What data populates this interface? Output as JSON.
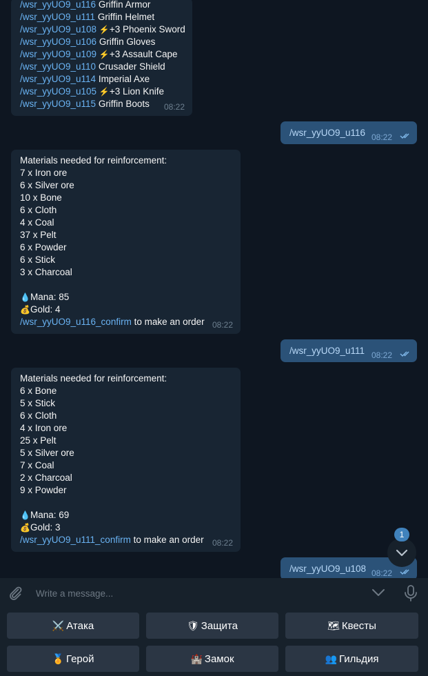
{
  "chat": {
    "msg1": {
      "lines": [
        {
          "cmd": "/wsr_yyUO9_u116",
          "text": " Griffin Armor"
        },
        {
          "cmd": "/wsr_yyUO9_u111",
          "text": " Griffin Helmet"
        },
        {
          "cmd": "/wsr_yyUO9_u108",
          "icon": "⚡",
          "text": "+3 Phoenix Sword"
        },
        {
          "cmd": "/wsr_yyUO9_u106",
          "text": " Griffin Gloves"
        },
        {
          "cmd": "/wsr_yyUO9_u109",
          "icon": "⚡",
          "text": "+3 Assault Cape"
        },
        {
          "cmd": "/wsr_yyUO9_u110",
          "text": " Crusader Shield"
        },
        {
          "cmd": "/wsr_yyUO9_u114",
          "text": " Imperial Axe"
        },
        {
          "cmd": "/wsr_yyUO9_u105",
          "icon": "⚡",
          "text": "+3 Lion Knife"
        },
        {
          "cmd": "/wsr_yyUO9_u115",
          "text": " Griffin Boots"
        }
      ],
      "time": "08:22"
    },
    "out1": {
      "text": "/wsr_yyUO9_u116",
      "time": "08:22"
    },
    "msg2": {
      "header": "Materials needed for reinforcement:",
      "items": [
        "7 x Iron ore",
        "6 x Silver ore",
        "10 x Bone",
        "6 x Cloth",
        "4 x Coal",
        "37 x Pelt",
        "6 x Powder",
        "6 x Stick",
        "3 x Charcoal"
      ],
      "mana": "Mana: 85",
      "gold": "Gold: 4",
      "confirm_cmd": "/wsr_yyUO9_u116_confirm",
      "confirm_text": " to make an order",
      "time": "08:22"
    },
    "out2": {
      "text": "/wsr_yyUO9_u111",
      "time": "08:22"
    },
    "msg3": {
      "header": "Materials needed for reinforcement:",
      "items": [
        "6 x Bone",
        "5 x Stick",
        "6 x Cloth",
        "4 x Iron ore",
        "25 x Pelt",
        "5 x Silver ore",
        "7 x Coal",
        "2 x Charcoal",
        "9 x Powder"
      ],
      "mana": "Mana: 69",
      "gold": "Gold: 3",
      "confirm_cmd": "/wsr_yyUO9_u111_confirm",
      "confirm_text": " to make an order",
      "time": "08:22"
    },
    "out3": {
      "text": "/wsr_yyUO9_u108",
      "time": "08:22"
    },
    "icons": {
      "mana": "💧",
      "gold": "💰"
    }
  },
  "scroll": {
    "badge": "1"
  },
  "composer": {
    "placeholder": "Write a message..."
  },
  "keyboard": {
    "buttons": [
      {
        "icon": "⚔️",
        "label": "Атака"
      },
      {
        "icon": "🛡",
        "label": "Защита"
      },
      {
        "icon": "🗺",
        "label": "Квесты"
      },
      {
        "icon": "🏅",
        "label": "Герой"
      },
      {
        "icon": "🏰",
        "label": "Замок"
      },
      {
        "icon": "👥",
        "label": "Гильдия"
      }
    ]
  },
  "colors": {
    "bg": "#0e1621",
    "incoming": "#182533",
    "outgoing": "#2b5278",
    "link": "#6ab3f3",
    "panel": "#17212b",
    "button": "#2b3644",
    "badge": "#4082bc"
  }
}
